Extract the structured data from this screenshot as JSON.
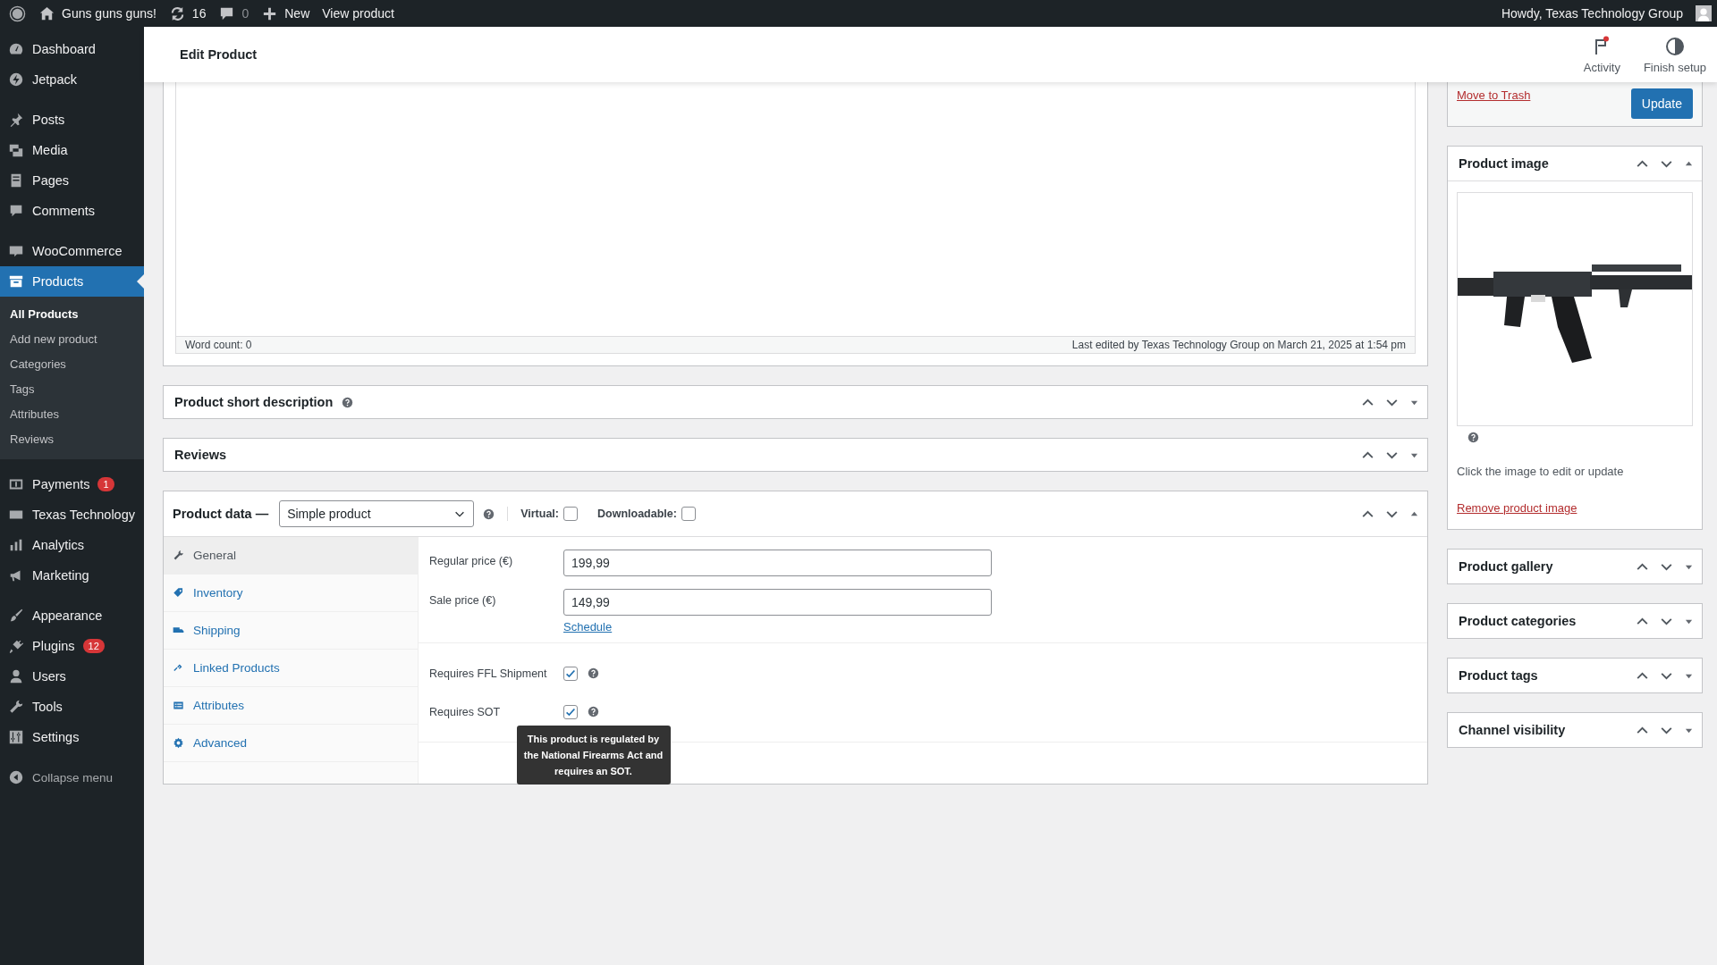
{
  "admin_bar": {
    "site": "Guns guns guns!",
    "updates": "16",
    "comments": "0",
    "new": "New",
    "view": "View product",
    "greeting": "Howdy, Texas Technology Group"
  },
  "sidebar": {
    "groups": [
      [
        {
          "label": "Dashboard",
          "selected": false
        },
        {
          "label": "Jetpack",
          "selected": false
        }
      ],
      [
        {
          "label": "Posts",
          "selected": false
        },
        {
          "label": "Media",
          "selected": false
        },
        {
          "label": "Pages",
          "selected": false
        },
        {
          "label": "Comments",
          "selected": false
        }
      ],
      [
        {
          "label": "WooCommerce",
          "selected": false
        },
        {
          "label": "Products",
          "selected": true,
          "children": [
            {
              "label": "All Products",
              "selected": true
            },
            {
              "label": "Add new product",
              "selected": false
            },
            {
              "label": "Categories",
              "selected": false
            },
            {
              "label": "Tags",
              "selected": false
            },
            {
              "label": "Attributes",
              "selected": false
            },
            {
              "label": "Reviews",
              "selected": false
            }
          ]
        }
      ],
      [
        {
          "label": "Payments",
          "selected": false,
          "badge": "1"
        },
        {
          "label": "Texas Technology",
          "selected": false
        },
        {
          "label": "Analytics",
          "selected": false
        },
        {
          "label": "Marketing",
          "selected": false
        }
      ],
      [
        {
          "label": "Appearance",
          "selected": false
        },
        {
          "label": "Plugins",
          "selected": false,
          "badge": "12"
        },
        {
          "label": "Users",
          "selected": false
        },
        {
          "label": "Tools",
          "selected": false
        },
        {
          "label": "Settings",
          "selected": false
        }
      ]
    ],
    "collapse": "Collapse menu"
  },
  "header": {
    "title": "Edit Product",
    "actions": [
      {
        "label": "Activity",
        "unread": true
      },
      {
        "label": "Finish setup",
        "unread": false
      }
    ]
  },
  "editor": {
    "word_count": "Word count: 0",
    "last_edited": "Last edited by Texas Technology Group on March 21, 2025 at 1:54 pm"
  },
  "panels": [
    {
      "title": "Product short description",
      "help": true,
      "expanded": false
    },
    {
      "title": "Reviews",
      "help": false,
      "expanded": false
    }
  ],
  "product_data": {
    "title": "Product data —",
    "type": "Simple product",
    "expanded": true,
    "options": [
      {
        "label": "Virtual:",
        "checked": false
      },
      {
        "label": "Downloadable:",
        "checked": false
      }
    ],
    "tabs": [
      {
        "label": "General",
        "selected": true
      },
      {
        "label": "Inventory",
        "selected": false
      },
      {
        "label": "Shipping",
        "selected": false
      },
      {
        "label": "Linked Products",
        "selected": false
      },
      {
        "label": "Attributes",
        "selected": false
      },
      {
        "label": "Advanced",
        "selected": false
      }
    ],
    "prices": [
      {
        "label": "Regular price (€)",
        "value": "199,99"
      },
      {
        "label": "Sale price (€)",
        "value": "149,99"
      }
    ],
    "schedule": "Schedule",
    "flags": [
      {
        "label": "Requires FFL Shipment",
        "checked": true
      },
      {
        "label": "Requires SOT",
        "checked": true,
        "tooltip": "This product is regulated by the National Firearms Act and requires an SOT."
      }
    ]
  },
  "publish": {
    "trash": "Move to Trash",
    "update": "Update"
  },
  "product_image": {
    "title": "Product image",
    "expanded": true,
    "caption": "Click the image to edit or update",
    "remove": "Remove product image"
  },
  "side_boxes": [
    {
      "title": "Product gallery",
      "expanded": false
    },
    {
      "title": "Product categories",
      "expanded": false
    },
    {
      "title": "Product tags",
      "expanded": false
    },
    {
      "title": "Channel visibility",
      "expanded": false
    }
  ]
}
